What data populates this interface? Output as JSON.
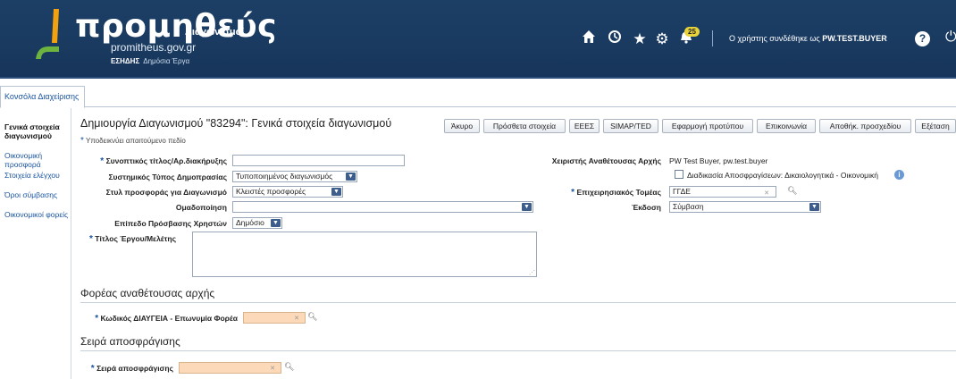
{
  "header": {
    "logo_title": "προμηθεύς",
    "logo_subtitle": "Διαγωνισμοί",
    "logo_url": "promitheus.gov.gr",
    "logo_org": "ΕΣΗΔΗΣ",
    "logo_org_sub": "Δημόσια Έργα",
    "notifications_count": "25",
    "user_prefix": "Ο χρήστης συνδέθηκε ως",
    "user_name": "PW.TEST.BUYER",
    "icons": [
      "home-icon",
      "clock-icon",
      "star-icon",
      "gear-icon",
      "bell-icon",
      "help-icon",
      "power-icon"
    ]
  },
  "tabs": [
    {
      "label": "Κονσόλα Διαχείρισης"
    }
  ],
  "sidebar": {
    "items": [
      {
        "label": "Γενικά στοιχεία διαγωνισμού",
        "active": true
      },
      {
        "label": "Οικονομική προσφορά",
        "active": false
      },
      {
        "label": "Στοιχεία ελέγχου",
        "active": false
      },
      {
        "label": "Όροι σύμβασης",
        "active": false
      },
      {
        "label": "Οικονομικοί φορείς",
        "active": false
      }
    ]
  },
  "main": {
    "title": "Δημιουργία Διαγωνισμού \"83294\": Γενικά στοιχεία διαγωνισμού",
    "buttons": [
      "Άκυρο",
      "Πρόσθετα στοιχεία",
      "ΕΕΕΣ",
      "SIMAP/TED",
      "Εφαρμογή προτύπου",
      "Επικοινωνία",
      "Αποθήκ. προσχεδίου",
      "Εξέταση"
    ],
    "required_note": "Υποδεικνύει απαιτούμενο πεδίο",
    "form": {
      "short_title_label": "Συνοπτικός τίτλος/Αρ.διακήρυξης",
      "short_title_value": "",
      "system_type_label": "Συστημικός Τύπος Δημοπρασίας",
      "system_type_value": "Τυποποιημένος διαγωνισμός",
      "offer_style_label": "Στυλ προσφοράς για Διαγωνισμό",
      "offer_style_value": "Κλειστές προσφορές",
      "grouping_label": "Ομαδοποίηση",
      "grouping_value": "",
      "access_level_label": "Επίπεδο Πρόσβασης Χρηστών",
      "access_level_value": "Δημόσιο",
      "project_title_label": "Τίτλος Έργου/Μελέτης",
      "project_title_value": "",
      "handler_label": "Χειριστής Αναθέτουσας Αρχής",
      "handler_value": "PW Test Buyer, pw.test.buyer",
      "unsealing_checkbox_label": "Διαδικασία Αποσφραγίσεων: Δικαιολογητικά - Οικονομική",
      "unsealing_checked": false,
      "sector_label": "Επιχειρησιακός Τομέας",
      "sector_value": "ΓΓΔΕ",
      "edition_label": "Έκδοση",
      "edition_value": "Σύμβαση"
    },
    "section_authority": {
      "title": "Φορέας αναθέτουσας αρχής",
      "code_label": "Κωδικός ΔΙΑΥΓΕΙΑ - Επωνυμία Φορέα",
      "code_value": ""
    },
    "section_unsealing": {
      "title": "Σειρά αποσφράγισης",
      "order_label": "Σειρά αποσφράγισης",
      "order_value": ""
    }
  },
  "colors": {
    "header_bg": "#1c3f66",
    "link": "#1a54a0",
    "required_field_bg": "#fcd9b8",
    "badge": "#e8d23a"
  }
}
